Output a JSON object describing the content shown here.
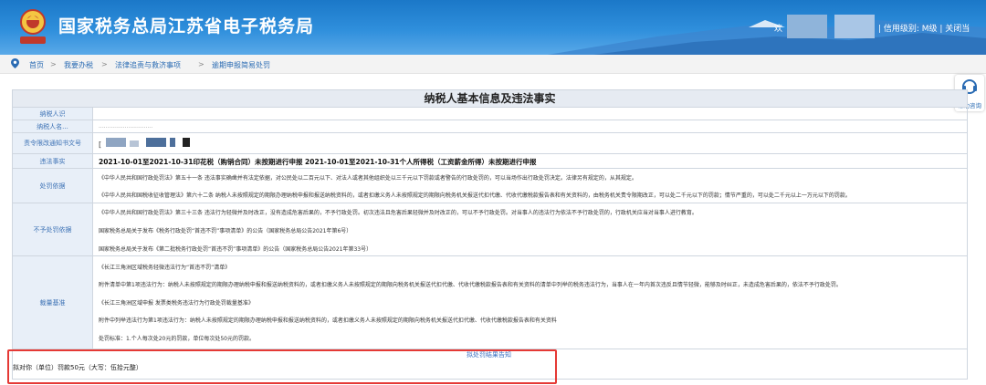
{
  "header": {
    "title": "国家税务总局江苏省电子税务局",
    "welcome": "欢",
    "user_info": "| 信用级别: M级 | 关闭当",
    "emblem_icon": "tax-emblem-icon"
  },
  "breadcrumb": {
    "items": [
      "首页",
      "我要办税",
      "法律追责与救济事项",
      "逾期申报简易处罚"
    ]
  },
  "help": {
    "label": "帮助咨询"
  },
  "main": {
    "title": "纳税人基本信息及违法事实",
    "rows": {
      "taxpayer_id_label": "纳税人识",
      "taxpayer_name_label": "纳税人名...",
      "taxpayer_name_value": "...............................",
      "notice_no_label": "责令限改通知书文号",
      "notice_no_value": "[",
      "violation_label": "违法事实",
      "violation_text": "2021-10-01至2021-10-31印花税（购销合同）未按期进行申报 2021-10-01至2021-10-31个人所得税（工资薪金所得）未按期进行申报",
      "basis_label": "处罚依据",
      "basis_1": "《中华人民共和国行政处罚法》第五十一条   违法事实确凿并有法定依据，对公民处以二百元以下、对法人或者其他组织处以三千元以下罚款或者警告的行政处罚的，可以当场作出行政处罚决定。法律另有规定的，从其规定。",
      "basis_2": "《中华人民共和国税收征收管理法》第六十二条   纳税人未按照规定的期限办理纳税申报和报送纳税资料的，或者扣缴义务人未按照规定的期限向税务机关报送代扣代缴、代收代缴税款报告表和有关资料的，由税务机关责令限期改正，可以处二千元以下的罚款；情节严重的，可以处二千元以上一万元以下的罚款。",
      "exempt_label": "不予处罚依据",
      "exempt_1": "《中华人民共和国行政处罚法》第三十三条   违法行为轻微并及时改正，没有造成危害后果的，不予行政处罚。初次违法且危害后果轻微并及时改正的，可以不予行政处罚。对当事人的违法行为依法不予行政处罚的，行政机关应当对当事人进行教育。",
      "exempt_2": "国家税务总局关于发布《税务行政处罚“首违不罚”事项清单》的公告（国家税务总局公告2021年第6号）",
      "exempt_3": "国家税务总局关于发布《第二批税务行政处罚“首违不罚”事项清单》的公告（国家税务总局公告2021年第33号）",
      "standard_label": "裁量基准",
      "standard_1": "《长江三角洲区域税务轻微违法行为“首违不罚”清单》",
      "standard_2": "附件清单中第1项违法行为：纳税人未按照规定的期限办理纳税申报和报送纳税资料的，或者扣缴义务人未按照规定的期限向税务机关报送代扣代缴、代收代缴税款报告表和有关资料的清单中列举的税务违法行为，当事人在一年内首次违反且情节轻微，能够及时纠正，未造成危害后果的，依法不予行政处罚。",
      "standard_3": "《长江三角洲区域申报 发票类税务违法行为行政处罚裁量基准》",
      "standard_4": "附件中列举违法行为第1项违法行为：纳税人未按照规定的期限办理纳税申报和报送纳税资料的，或者扣缴义务人未按照规定的期限向税务机关报送代扣代缴、代收代缴税款报告表和有关资料",
      "standard_5": "处罚标准：1.个人每次处20元的罚款，单位每次处50元的罚款。"
    },
    "result_link": "拟处罚结果告知",
    "penalty_text": "拟对你（单位）罚款50元（大写：伍拾元整）"
  }
}
